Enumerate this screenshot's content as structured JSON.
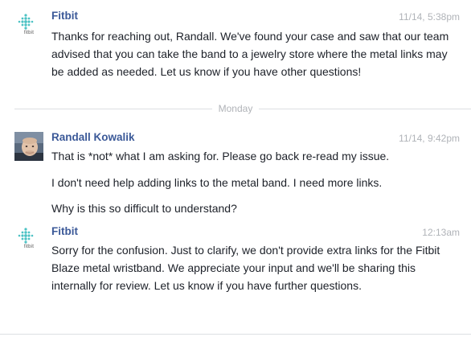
{
  "messages": [
    {
      "sender": "Fitbit",
      "logo_text": "fitbit",
      "time": "11/14, 5:38pm",
      "paragraphs": [
        "Thanks for reaching out, Randall. We've found your case and saw that our team advised that you can take the band to a jewelry store where the metal links may be added as needed. Let us know if you have other questions!"
      ]
    },
    {
      "sender": "Randall Kowalik",
      "time": "11/14, 9:42pm",
      "paragraphs": [
        "That is *not* what I am asking for. Please go back re-read  my issue.",
        "I don't need help adding links to the metal band. I need more links.",
        "Why is this so difficult to understand?"
      ]
    },
    {
      "sender": "Fitbit",
      "logo_text": "fitbit",
      "time": "12:13am",
      "paragraphs": [
        "Sorry for the confusion. Just to clarify, we don't provide extra links for the Fitbit Blaze metal wristband. We appreciate your input and we'll be sharing this internally for review. Let us know if you have further questions."
      ]
    }
  ],
  "day_divider": "Monday",
  "colors": {
    "sender": "#3b5998",
    "timestamp": "#b0b3b8",
    "body": "#1d2129",
    "fitbit_teal": "#4cc2c4"
  },
  "icons": {
    "fitbit": "fitbit-logo-icon",
    "user": "user-avatar"
  }
}
